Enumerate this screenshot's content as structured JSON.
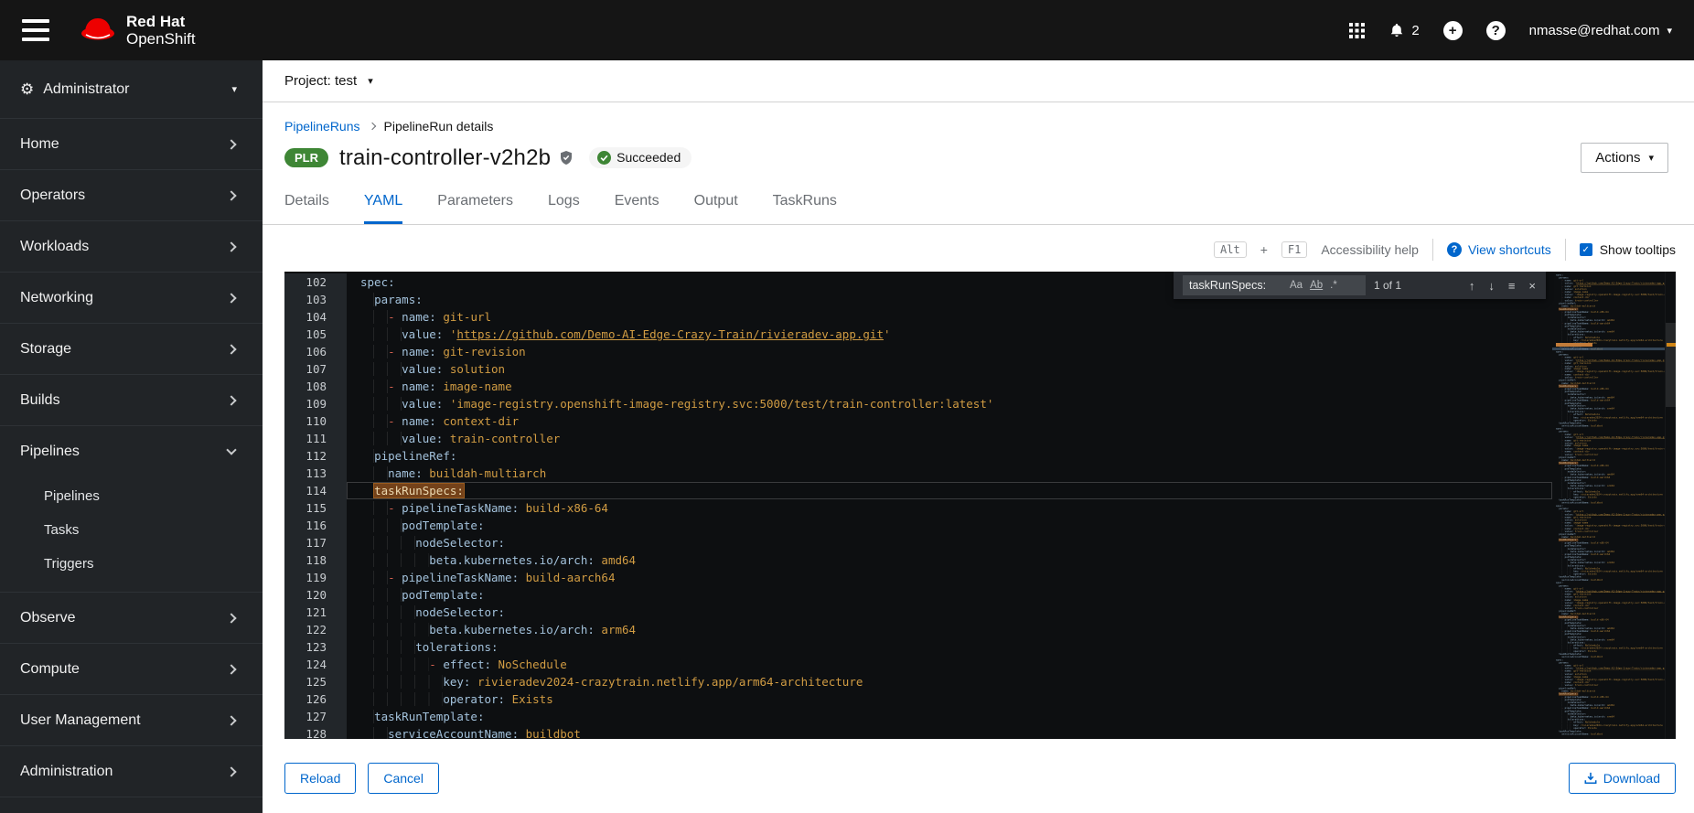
{
  "masthead": {
    "brand_line1": "Red Hat",
    "brand_line2": "OpenShift",
    "notification_count": "2",
    "user": "nmasse@redhat.com"
  },
  "sidebar": {
    "perspective_label": "Administrator",
    "items": [
      {
        "label": "Home",
        "chevron": "right"
      },
      {
        "label": "Operators",
        "chevron": "right"
      },
      {
        "label": "Workloads",
        "chevron": "right"
      },
      {
        "label": "Networking",
        "chevron": "right"
      },
      {
        "label": "Storage",
        "chevron": "right"
      },
      {
        "label": "Builds",
        "chevron": "right"
      },
      {
        "label": "Pipelines",
        "chevron": "down",
        "children": [
          "Pipelines",
          "Tasks",
          "Triggers"
        ]
      },
      {
        "label": "Observe",
        "chevron": "right"
      },
      {
        "label": "Compute",
        "chevron": "right"
      },
      {
        "label": "User Management",
        "chevron": "right"
      },
      {
        "label": "Administration",
        "chevron": "right"
      }
    ]
  },
  "project_bar": {
    "label": "Project: test"
  },
  "breadcrumb": {
    "link": "PipelineRuns",
    "current": "PipelineRun details"
  },
  "page_header": {
    "badge": "PLR",
    "title": "train-controller-v2h2b",
    "status": "Succeeded",
    "actions_label": "Actions"
  },
  "tabs": {
    "items": [
      "Details",
      "YAML",
      "Parameters",
      "Logs",
      "Events",
      "Output",
      "TaskRuns"
    ],
    "active": "YAML"
  },
  "editor_toolbar": {
    "key1": "Alt",
    "plus_sign": "+",
    "key2": "F1",
    "accessibility_label": "Accessibility help",
    "view_shortcuts": "View shortcuts",
    "show_tooltips": "Show tooltips",
    "tooltips_checked": true
  },
  "find_widget": {
    "query": "taskRunSpecs:",
    "match_case": "Aa",
    "whole_word": "Ab",
    "regex": ".*",
    "results": "1 of 1"
  },
  "icons": {
    "caret_down": "▾",
    "gear": "⚙",
    "question_mark": "?",
    "plus": "+",
    "check": "✓",
    "arrow_up": "↑",
    "arrow_down": "↓",
    "selection_find": "≡",
    "close": "×"
  },
  "editor": {
    "current_line": 114,
    "lines": [
      {
        "n": 102,
        "toks": [
          [
            "k",
            "spec:"
          ]
        ]
      },
      {
        "n": 103,
        "toks": [
          [
            "i",
            "  "
          ],
          [
            "k",
            "params:"
          ]
        ]
      },
      {
        "n": 104,
        "toks": [
          [
            "i",
            "    "
          ],
          [
            "d",
            "- "
          ],
          [
            "k",
            "name:"
          ],
          [
            "p",
            " "
          ],
          [
            "v",
            "git-url"
          ]
        ]
      },
      {
        "n": 105,
        "toks": [
          [
            "i",
            "      "
          ],
          [
            "k",
            "value:"
          ],
          [
            "p",
            " "
          ],
          [
            "v",
            "'"
          ],
          [
            "u",
            "https://github.com/Demo-AI-Edge-Crazy-Train/rivieradev-app.git"
          ],
          [
            "v",
            "'"
          ]
        ]
      },
      {
        "n": 106,
        "toks": [
          [
            "i",
            "    "
          ],
          [
            "d",
            "- "
          ],
          [
            "k",
            "name:"
          ],
          [
            "p",
            " "
          ],
          [
            "v",
            "git-revision"
          ]
        ]
      },
      {
        "n": 107,
        "toks": [
          [
            "i",
            "      "
          ],
          [
            "k",
            "value:"
          ],
          [
            "p",
            " "
          ],
          [
            "v",
            "solution"
          ]
        ]
      },
      {
        "n": 108,
        "toks": [
          [
            "i",
            "    "
          ],
          [
            "d",
            "- "
          ],
          [
            "k",
            "name:"
          ],
          [
            "p",
            " "
          ],
          [
            "v",
            "image-name"
          ]
        ]
      },
      {
        "n": 109,
        "toks": [
          [
            "i",
            "      "
          ],
          [
            "k",
            "value:"
          ],
          [
            "p",
            " "
          ],
          [
            "v",
            "'image-registry.openshift-image-registry.svc:5000/test/train-controller:latest'"
          ]
        ]
      },
      {
        "n": 110,
        "toks": [
          [
            "i",
            "    "
          ],
          [
            "d",
            "- "
          ],
          [
            "k",
            "name:"
          ],
          [
            "p",
            " "
          ],
          [
            "v",
            "context-dir"
          ]
        ]
      },
      {
        "n": 111,
        "toks": [
          [
            "i",
            "      "
          ],
          [
            "k",
            "value:"
          ],
          [
            "p",
            " "
          ],
          [
            "v",
            "train-controller"
          ]
        ]
      },
      {
        "n": 112,
        "toks": [
          [
            "i",
            "  "
          ],
          [
            "k",
            "pipelineRef:"
          ]
        ]
      },
      {
        "n": 113,
        "toks": [
          [
            "i",
            "    "
          ],
          [
            "k",
            "name:"
          ],
          [
            "p",
            " "
          ],
          [
            "v",
            "buildah-multiarch"
          ]
        ]
      },
      {
        "n": 114,
        "toks": [
          [
            "i",
            "  "
          ],
          [
            "m",
            "taskRunSpecs:"
          ]
        ]
      },
      {
        "n": 115,
        "toks": [
          [
            "i",
            "    "
          ],
          [
            "d",
            "- "
          ],
          [
            "k",
            "pipelineTaskName:"
          ],
          [
            "p",
            " "
          ],
          [
            "v",
            "build-x86-64"
          ]
        ]
      },
      {
        "n": 116,
        "toks": [
          [
            "i",
            "      "
          ],
          [
            "k",
            "podTemplate:"
          ]
        ]
      },
      {
        "n": 117,
        "toks": [
          [
            "i",
            "        "
          ],
          [
            "k",
            "nodeSelector:"
          ]
        ]
      },
      {
        "n": 118,
        "toks": [
          [
            "i",
            "          "
          ],
          [
            "k",
            "beta.kubernetes.io/arch:"
          ],
          [
            "p",
            " "
          ],
          [
            "v",
            "amd64"
          ]
        ]
      },
      {
        "n": 119,
        "toks": [
          [
            "i",
            "    "
          ],
          [
            "d",
            "- "
          ],
          [
            "k",
            "pipelineTaskName:"
          ],
          [
            "p",
            " "
          ],
          [
            "v",
            "build-aarch64"
          ]
        ]
      },
      {
        "n": 120,
        "toks": [
          [
            "i",
            "      "
          ],
          [
            "k",
            "podTemplate:"
          ]
        ]
      },
      {
        "n": 121,
        "toks": [
          [
            "i",
            "        "
          ],
          [
            "k",
            "nodeSelector:"
          ]
        ]
      },
      {
        "n": 122,
        "toks": [
          [
            "i",
            "          "
          ],
          [
            "k",
            "beta.kubernetes.io/arch:"
          ],
          [
            "p",
            " "
          ],
          [
            "v",
            "arm64"
          ]
        ]
      },
      {
        "n": 123,
        "toks": [
          [
            "i",
            "        "
          ],
          [
            "k",
            "tolerations:"
          ]
        ]
      },
      {
        "n": 124,
        "toks": [
          [
            "i",
            "          "
          ],
          [
            "d",
            "- "
          ],
          [
            "k",
            "effect:"
          ],
          [
            "p",
            " "
          ],
          [
            "v",
            "NoSchedule"
          ]
        ]
      },
      {
        "n": 125,
        "toks": [
          [
            "i",
            "            "
          ],
          [
            "k",
            "key:"
          ],
          [
            "p",
            " "
          ],
          [
            "v",
            "rivieradev2024-crazytrain.netlify.app/arm64-architecture"
          ]
        ]
      },
      {
        "n": 126,
        "toks": [
          [
            "i",
            "            "
          ],
          [
            "k",
            "operator:"
          ],
          [
            "p",
            " "
          ],
          [
            "v",
            "Exists"
          ]
        ]
      },
      {
        "n": 127,
        "toks": [
          [
            "i",
            "  "
          ],
          [
            "k",
            "taskRunTemplate:"
          ]
        ]
      },
      {
        "n": 128,
        "toks": [
          [
            "i",
            "    "
          ],
          [
            "k",
            "serviceAccountName:"
          ],
          [
            "p",
            " "
          ],
          [
            "v",
            "buildbot"
          ]
        ]
      }
    ]
  },
  "footer": {
    "reload": "Reload",
    "cancel": "Cancel",
    "download": "Download"
  },
  "colors": {
    "accent_blue": "#0066cc",
    "success_green": "#3e8635",
    "badge_green": "#3e8635",
    "masthead_bg": "#151515",
    "sidebar_bg": "#212427",
    "editor_bg": "#0d0f11",
    "yaml_key": "#a3c2dc",
    "yaml_value": "#d19c43",
    "yaml_dash": "#d1604f",
    "find_match_bg": "#74421a"
  }
}
